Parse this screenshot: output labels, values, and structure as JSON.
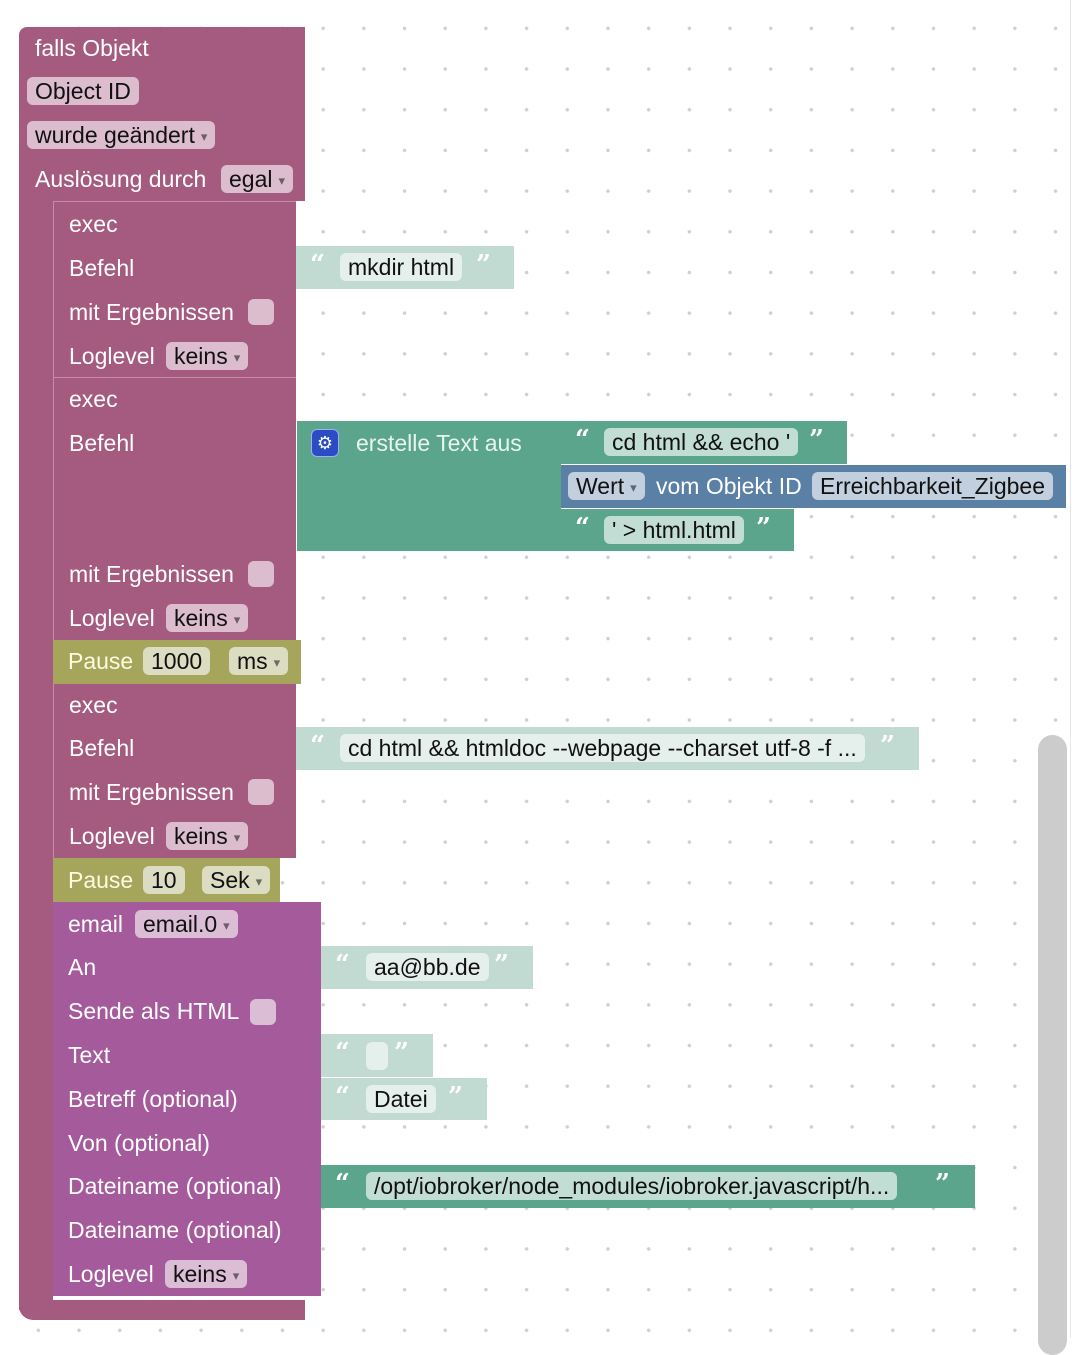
{
  "trigger": {
    "title": "falls Objekt",
    "object_id": "Object ID",
    "event": "wurde geändert",
    "trigger_by_label": "Auslösung durch",
    "trigger_by_value": "egal"
  },
  "exec1": {
    "title": "exec",
    "command_label": "Befehl",
    "command_value": "mkdir html",
    "with_results_label": "mit Ergebnissen",
    "with_results_checked": false,
    "loglevel_label": "Loglevel",
    "loglevel_value": "keins"
  },
  "exec2": {
    "title": "exec",
    "command_label": "Befehl",
    "join_label": "erstelle Text aus",
    "join_parts": {
      "part1": "cd html && echo '",
      "get_mode": "Wert",
      "get_label": "vom Objekt ID",
      "get_object": "Erreichbarkeit_Zigbee",
      "part3": "' > html.html"
    },
    "with_results_label": "mit Ergebnissen",
    "with_results_checked": false,
    "loglevel_label": "Loglevel",
    "loglevel_value": "keins"
  },
  "pause1": {
    "label": "Pause",
    "value": "1000",
    "unit": "ms"
  },
  "exec3": {
    "title": "exec",
    "command_label": "Befehl",
    "command_value": "cd html && htmldoc --webpage --charset utf-8 -f ...",
    "with_results_label": "mit Ergebnissen",
    "with_results_checked": false,
    "loglevel_label": "Loglevel",
    "loglevel_value": "keins"
  },
  "pause2": {
    "label": "Pause",
    "value": "10",
    "unit": "Sek"
  },
  "email": {
    "title": "email",
    "instance": "email.0",
    "to_label": "An",
    "to_value": "aa@bb.de",
    "html_label": "Sende als HTML",
    "html_checked": false,
    "text_label": "Text",
    "text_value": "",
    "subject_label": "Betreff (optional)",
    "subject_value": "Datei",
    "from_label": "Von (optional)",
    "file1_label": "Dateiname (optional)",
    "file1_value": "/opt/iobroker/node_modules/iobroker.javascript/h...",
    "file2_label": "Dateiname (optional)",
    "loglevel_label": "Loglevel",
    "loglevel_value": "keins"
  },
  "icons": {
    "gear": "⚙"
  }
}
